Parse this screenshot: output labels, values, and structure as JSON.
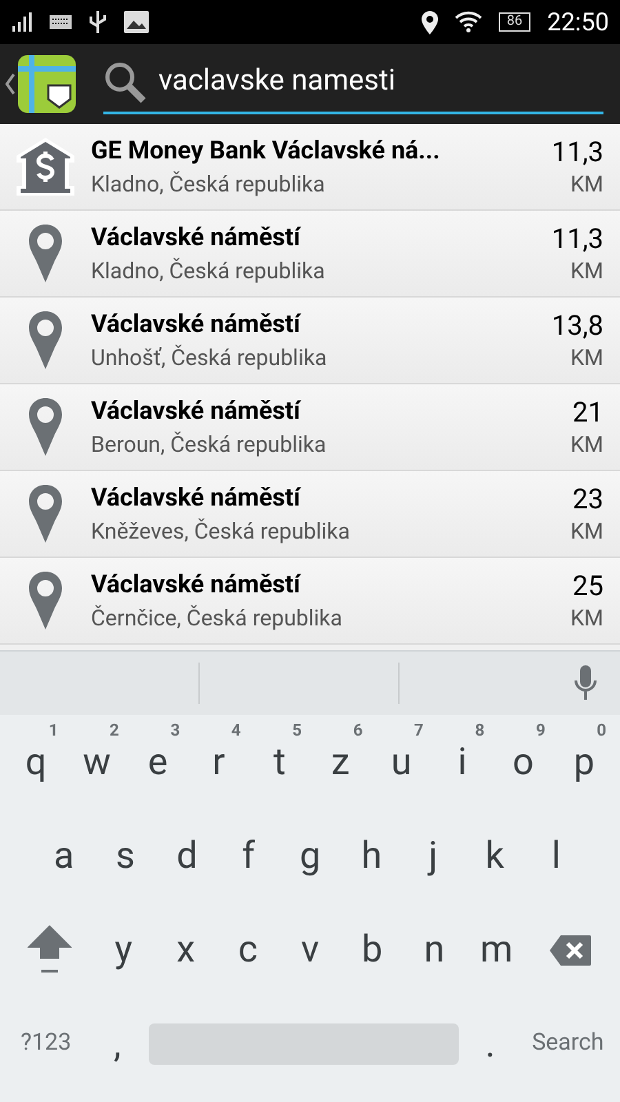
{
  "status_bar": {
    "battery": "86",
    "time": "22:50"
  },
  "search": {
    "value": "vaclavske namesti"
  },
  "results": [
    {
      "kind": "bank",
      "title": "GE Money Bank Václavské ná...",
      "subtitle": "Kladno, Česká republika",
      "distance": "11,3",
      "unit": "KM"
    },
    {
      "kind": "place",
      "title": "Václavské náměstí",
      "subtitle": "Kladno, Česká republika",
      "distance": "11,3",
      "unit": "KM"
    },
    {
      "kind": "place",
      "title": "Václavské náměstí",
      "subtitle": "Unhošť, Česká republika",
      "distance": "13,8",
      "unit": "KM"
    },
    {
      "kind": "place",
      "title": "Václavské náměstí",
      "subtitle": "Beroun, Česká republika",
      "distance": "21",
      "unit": "KM"
    },
    {
      "kind": "place",
      "title": "Václavské náměstí",
      "subtitle": "Kněževes, Česká republika",
      "distance": "23",
      "unit": "KM"
    },
    {
      "kind": "place",
      "title": "Václavské náměstí",
      "subtitle": "Černčice, Česká republika",
      "distance": "25",
      "unit": "KM"
    }
  ],
  "keyboard": {
    "rows": [
      [
        {
          "kind": "char",
          "label": "q",
          "hint": "1"
        },
        {
          "kind": "char",
          "label": "w",
          "hint": "2"
        },
        {
          "kind": "char",
          "label": "e",
          "hint": "3"
        },
        {
          "kind": "char",
          "label": "r",
          "hint": "4"
        },
        {
          "kind": "char",
          "label": "t",
          "hint": "5"
        },
        {
          "kind": "char",
          "label": "z",
          "hint": "6"
        },
        {
          "kind": "char",
          "label": "u",
          "hint": "7"
        },
        {
          "kind": "char",
          "label": "i",
          "hint": "8"
        },
        {
          "kind": "char",
          "label": "o",
          "hint": "9"
        },
        {
          "kind": "char",
          "label": "p",
          "hint": "0"
        }
      ],
      [
        {
          "kind": "char",
          "label": "a"
        },
        {
          "kind": "char",
          "label": "s"
        },
        {
          "kind": "char",
          "label": "d"
        },
        {
          "kind": "char",
          "label": "f"
        },
        {
          "kind": "char",
          "label": "g"
        },
        {
          "kind": "char",
          "label": "h"
        },
        {
          "kind": "char",
          "label": "j"
        },
        {
          "kind": "char",
          "label": "k"
        },
        {
          "kind": "char",
          "label": "l"
        }
      ],
      [
        {
          "kind": "shift"
        },
        {
          "kind": "char",
          "label": "y"
        },
        {
          "kind": "char",
          "label": "x"
        },
        {
          "kind": "char",
          "label": "c"
        },
        {
          "kind": "char",
          "label": "v"
        },
        {
          "kind": "char",
          "label": "b"
        },
        {
          "kind": "char",
          "label": "n"
        },
        {
          "kind": "char",
          "label": "m"
        },
        {
          "kind": "backspace"
        }
      ]
    ],
    "bottom_row": [
      {
        "kind": "mode",
        "label": "?123"
      },
      {
        "kind": "char",
        "label": ","
      },
      {
        "kind": "space"
      },
      {
        "kind": "char",
        "label": "."
      },
      {
        "kind": "action",
        "label": "Search"
      }
    ]
  }
}
